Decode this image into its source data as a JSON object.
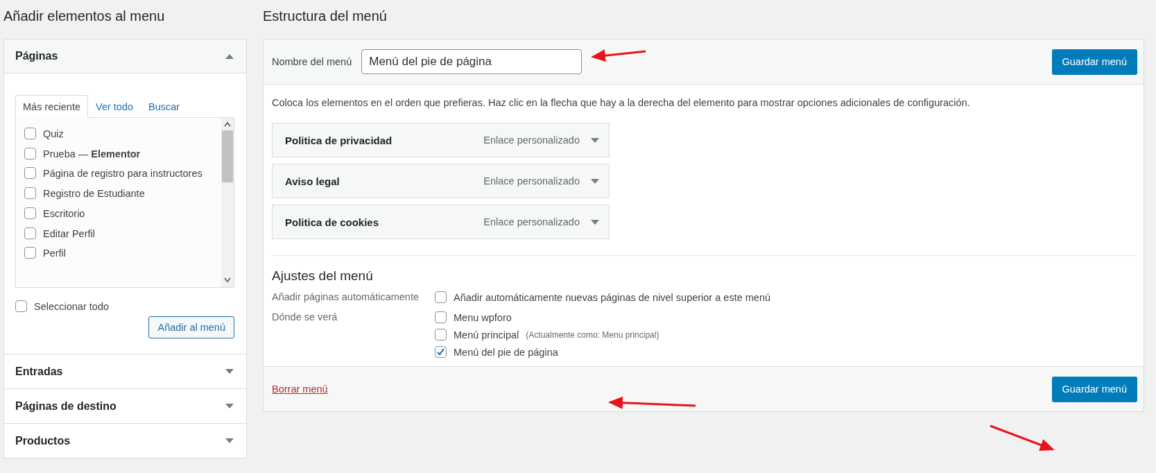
{
  "left": {
    "title": "Añadir elementos al menu",
    "sections": [
      {
        "title": "Páginas",
        "expanded": true,
        "tabs": [
          {
            "label": "Más reciente",
            "selected": true
          },
          {
            "label": "Ver todo",
            "selected": false
          },
          {
            "label": "Buscar",
            "selected": false
          }
        ],
        "items": [
          {
            "label": "Quiz",
            "checked": false
          },
          {
            "label": "Prueba — **Elementor**",
            "checked": false
          },
          {
            "label": "Página de registro para instructores",
            "checked": false
          },
          {
            "label": "Registro de Estudiante",
            "checked": false
          },
          {
            "label": "Escritorio",
            "checked": false
          },
          {
            "label": "Editar Perfil",
            "checked": false
          },
          {
            "label": "Perfil",
            "checked": false
          }
        ],
        "select_all": {
          "label": "Seleccionar todo",
          "checked": false
        },
        "add_button": "Añadir al menú"
      },
      {
        "title": "Entradas",
        "expanded": false
      },
      {
        "title": "Páginas de destino",
        "expanded": false
      },
      {
        "title": "Productos",
        "expanded": false
      }
    ]
  },
  "right": {
    "title": "Estructura del menú",
    "name_label": "Nombre del menú",
    "name_value": "Menú del pie de página",
    "save_button": "Guardar menú",
    "instructions": "Coloca los elementos en el orden que prefieras. Haz clic en la flecha que hay a la derecha del elemento para mostrar opciones adicionales de configuración.",
    "items": [
      {
        "title": "Politica de privacidad",
        "type": "Enlace personalizado"
      },
      {
        "title": "Aviso legal",
        "type": "Enlace personalizado"
      },
      {
        "title": "Politica de cookies",
        "type": "Enlace personalizado"
      }
    ],
    "settings": {
      "title": "Ajustes del menú",
      "rows": [
        {
          "label": "Añadir páginas automáticamente",
          "options": [
            {
              "label": "Añadir automáticamente nuevas páginas de nivel superior a este menú",
              "checked": false
            }
          ]
        },
        {
          "label": "Dónde se verá",
          "options": [
            {
              "label": "Menu wpforo",
              "checked": false
            },
            {
              "label": "Menú principal",
              "note": "(Actualmente como: Menu principal)",
              "checked": false
            },
            {
              "label": "Menú del pie de página",
              "checked": true
            }
          ]
        }
      ]
    },
    "delete_link": "Borrar menú",
    "save_button_bottom": "Guardar menú"
  }
}
